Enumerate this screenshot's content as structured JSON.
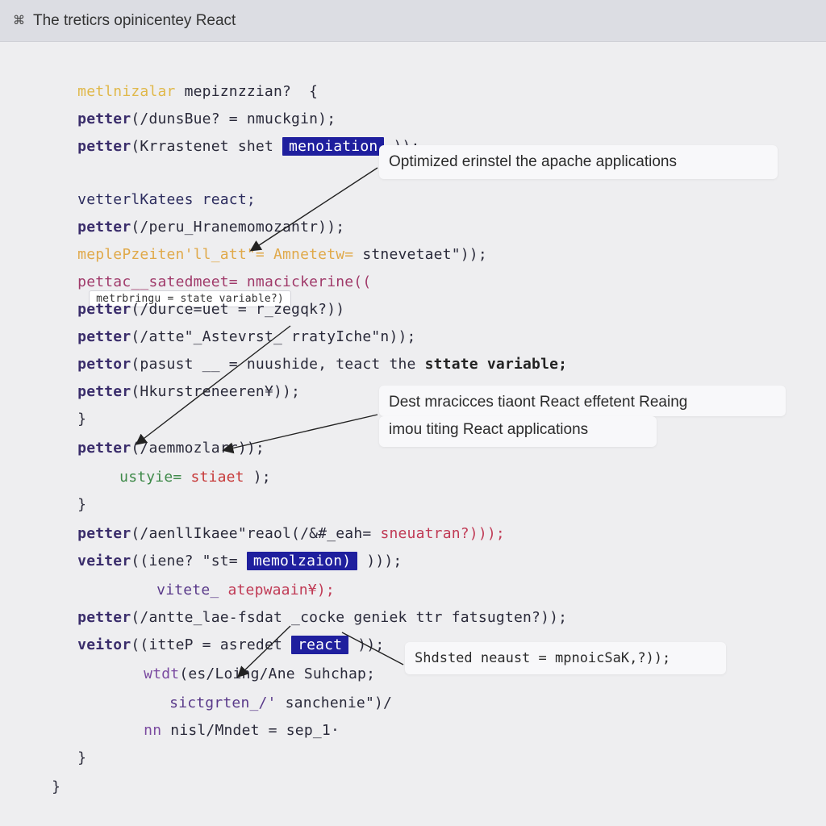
{
  "window": {
    "icon": "pin-icon",
    "title": "The treticrs opinicentey React"
  },
  "code": {
    "l1": {
      "a": "metlnizalar",
      "b": " mepiznzzian?  {"
    },
    "l2": {
      "a": "petter",
      "b": "(/dunsBue? = nmuckgin);"
    },
    "l3": {
      "a": "petter",
      "b": "(Krrastenet shet ",
      "hl": "menoiation",
      "c": " ));"
    },
    "l4": {
      "a": "vetterlKatees react;"
    },
    "l5": {
      "a": "petter",
      "b": "(/peru_Hranemomozantr));"
    },
    "l6": {
      "a": "meplePzeiten'll_att\"= Amnetetw= ",
      "b": "stnevetaet\"));"
    },
    "l7": {
      "a": "pettac_",
      "b": "_satedmeet= nmacickerine((",
      "inline": "metrbringu = state variable?)"
    },
    "l8": {
      "a": "petter",
      "b": "(/durce=uet = r_zegqk?))"
    },
    "l9": {
      "a": "petter",
      "b": "(/atte\"_Astevrst_ rratyIche\"n));"
    },
    "l10": {
      "a": "pettor",
      "b": "(pasust __ = nuushide, teact the ",
      "c": "sttate variable;"
    },
    "l11": {
      "a": "petter",
      "b": "(Hkurstreneeren¥));"
    },
    "l12": {
      "a": "}"
    },
    "l13": {
      "a": "petter",
      "b": "(/aemmozlarr));"
    },
    "l14": {
      "a": "ustyie= ",
      "b": "stiaet ",
      "c": ");"
    },
    "l15": {
      "a": "}"
    },
    "l16": {
      "a": "petter",
      "b": "(/aenllIkaee\"reaol(/&#_eah= ",
      "c": "sneuatran?)));"
    },
    "l17": {
      "a": "veiter",
      "b": "((iene? \"st= ",
      "hl": "memolzaion)",
      "c": " )));"
    },
    "l18": {
      "a": "vitete_ ",
      "b": "atepwaain¥);"
    },
    "l19": {
      "a": "petter",
      "b": "(/antte_lae-fsdat _cocke geniek ttr fatsugten?));"
    },
    "l20": {
      "a": "veitor",
      "b": "((itteP = asredet ",
      "hl": "react",
      "c": " ));"
    },
    "l21": {
      "a": "wtdt",
      "b": "(es/Loing/Ane Suhchap;"
    },
    "l22": {
      "a": "sictgrten_/' ",
      "b": "sanchenie\")/"
    },
    "l23": {
      "a": "nn ",
      "b": "nisl/Mndet = sep_1·"
    },
    "l24": {
      "a": "}"
    },
    "l25": {
      "a": "}"
    }
  },
  "callouts": {
    "c1": "Optimized erinstel the apache applications",
    "c2a": "Dest mracicces tiaont React effetent Reaing",
    "c2b": "imou titing React applications",
    "c3": "Shdsted neaust = mpnoicSaK,?));"
  },
  "colors": {
    "highlight": "#1f1f9e",
    "keyword": "#3a2d6b",
    "background": "#eeeef0"
  }
}
